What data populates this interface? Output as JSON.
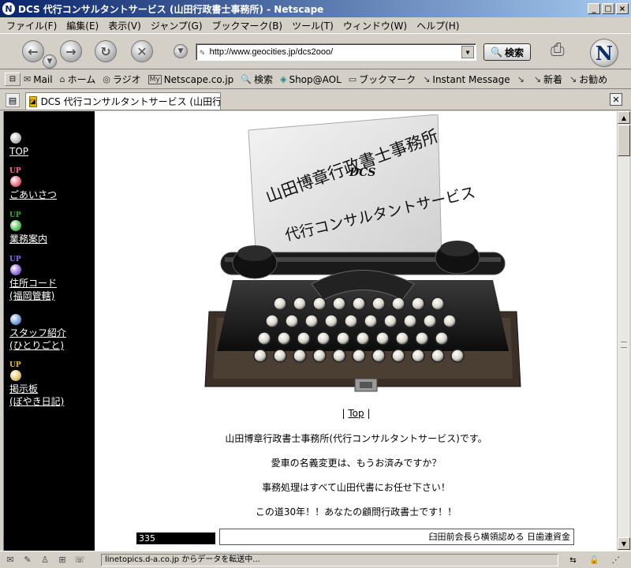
{
  "window": {
    "title": "DCS 代行コンサルタントサービス (山田行政書士事務所) - Netscape",
    "app_icon": "N"
  },
  "menu": [
    "ファイル(F)",
    "編集(E)",
    "表示(V)",
    "ジャンプ(G)",
    "ブックマーク(B)",
    "ツール(T)",
    "ウィンドウ(W)",
    "ヘルプ(H)"
  ],
  "navbar": {
    "url": "http://www.geocities.jp/dcs2ooo/",
    "search_label": "検索",
    "logo": "N"
  },
  "bookmarks": [
    {
      "icon": "mail-icon",
      "glyph": "✉",
      "label": "Mail"
    },
    {
      "icon": "home-icon",
      "glyph": "⌂",
      "label": "ホーム"
    },
    {
      "icon": "radio-icon",
      "glyph": "◎",
      "label": "ラジオ"
    },
    {
      "icon": "my-icon",
      "glyph": "My",
      "label": "Netscape.co.jp"
    },
    {
      "icon": "search-icon",
      "glyph": "🔍",
      "label": "検索"
    },
    {
      "icon": "aol-icon",
      "glyph": "◈",
      "label": "Shop@AOL"
    },
    {
      "icon": "folder-icon",
      "glyph": "▭",
      "label": "ブックマーク"
    },
    {
      "icon": "link-icon",
      "glyph": "↘",
      "label": "Instant Message"
    },
    {
      "icon": "link-icon",
      "glyph": "↘",
      "label": ""
    },
    {
      "icon": "link-icon",
      "glyph": "↘",
      "label": "新着"
    },
    {
      "icon": "link-icon",
      "glyph": "↘",
      "label": "お勧め"
    }
  ],
  "tab": {
    "label": "DCS 代行コンサルタントサービス (山田行政..."
  },
  "sidenav": [
    {
      "up": "",
      "ball_color": "#c8c8c8",
      "lines": [
        "TOP"
      ]
    },
    {
      "up": "UP",
      "ball_color": "#f08090",
      "lines": [
        "ごあいさつ"
      ]
    },
    {
      "up": "UP",
      "ball_color": "#70cc70",
      "lines": [
        "業務案内"
      ]
    },
    {
      "up": "UP",
      "ball_color": "#a080e0",
      "lines": [
        "住所コード",
        "(福岡管轄)"
      ]
    },
    {
      "up": "",
      "ball_color": "#88aadd",
      "lines": [
        "スタッフ紹介",
        "(ひとりごと)"
      ]
    },
    {
      "up": "UP",
      "ball_color": "#e8d080",
      "lines": [
        "掲示板",
        "(ぼやき日記)"
      ]
    }
  ],
  "hero": {
    "line1": "山田博章行政書士事務所",
    "line2": "DCS",
    "line3": "代行コンサルタントサービス"
  },
  "main": {
    "top_left": "| ",
    "top_link": "Top",
    "top_right": " |",
    "lines": [
      "山田博章行政書士事務所(代行コンサルタントサービス)です。",
      "愛車の名義変更は、もうお済みですか？",
      "事務処理はすべて山田代書にお任せ下さい！",
      "この道30年！！あなたの顧問行政書士です！！"
    ],
    "counter": "335",
    "marquee": "臼田前会長ら横領認める 日歯連資金"
  },
  "status": {
    "text": "linetopics.d-a.co.jp からデータを転送中..."
  },
  "colors": {
    "titlebar_start": "#0a246a",
    "chrome": "#d4d0c8",
    "sidebar": "#000000"
  }
}
